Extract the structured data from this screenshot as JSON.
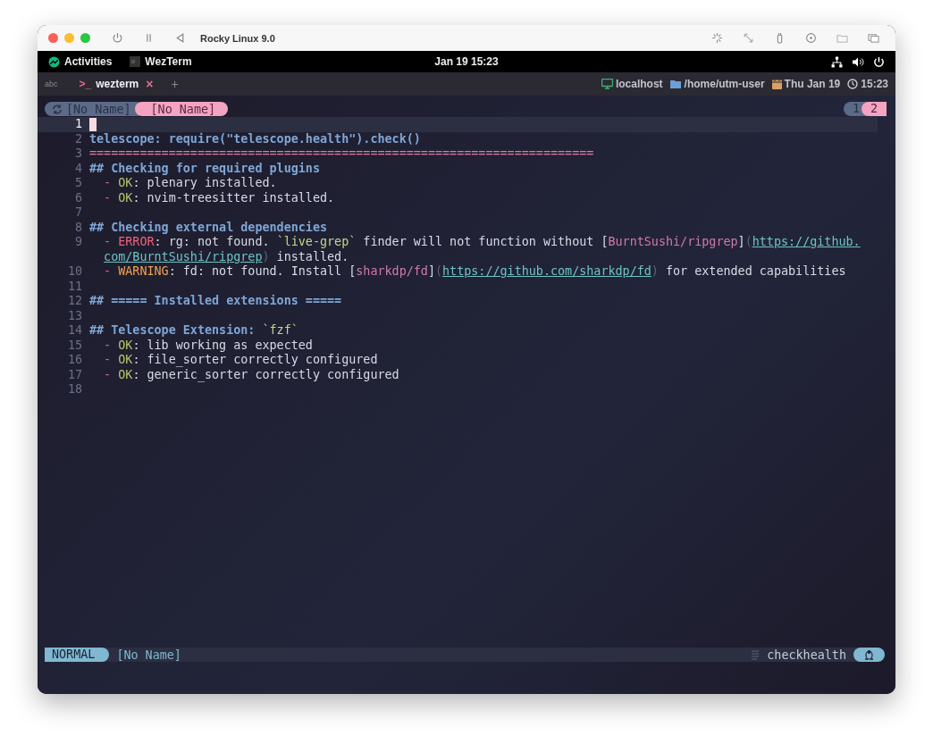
{
  "window": {
    "title": "Rocky Linux 9.0"
  },
  "top_bar": {
    "activities": "Activities",
    "app": "WezTerm",
    "clock": "Jan 19  15:23"
  },
  "terminal_tabs": {
    "left_label": "abc",
    "tabs": [
      {
        "icon": ">_",
        "label": "wezterm",
        "close": "×",
        "selected": true
      }
    ],
    "new_tab": "+",
    "status": [
      {
        "kind": "host",
        "text": "localhost"
      },
      {
        "kind": "folder",
        "text": "/home/utm-user"
      },
      {
        "kind": "date",
        "text": "Thu Jan 19"
      },
      {
        "kind": "time",
        "text": "15:23"
      }
    ]
  },
  "buffers": [
    {
      "label": "[No Name]",
      "selected": false
    },
    {
      "label": "[No Name]",
      "selected": true
    }
  ],
  "tabpages": [
    {
      "label": "1",
      "selected": false
    },
    {
      "label": "2",
      "selected": true
    }
  ],
  "editor": {
    "lines": [
      {
        "number": "1",
        "current": true
      },
      {
        "number": "2",
        "current": false,
        "segments": [
          {
            "kind": "heading",
            "text": "telescope: require(\"telescope.health\").check()"
          }
        ]
      },
      {
        "number": "3",
        "current": false,
        "segments": [
          {
            "kind": "separator",
            "text": "======================================================================"
          }
        ]
      },
      {
        "number": "4",
        "current": false,
        "segments": [
          {
            "kind": "heading",
            "text": "## Checking for required plugins"
          }
        ]
      },
      {
        "number": "5",
        "current": false,
        "segments": [
          {
            "kind": "dash",
            "text": "  - "
          },
          {
            "kind": "ok",
            "text": "OK"
          },
          {
            "kind": "plain",
            "text": ": plenary installed."
          }
        ]
      },
      {
        "number": "6",
        "current": false,
        "segments": [
          {
            "kind": "dash",
            "text": "  - "
          },
          {
            "kind": "ok",
            "text": "OK"
          },
          {
            "kind": "plain",
            "text": ": nvim-treesitter installed."
          }
        ]
      },
      {
        "number": "7",
        "current": false
      },
      {
        "number": "8",
        "current": false,
        "segments": [
          {
            "kind": "heading",
            "text": "## Checking external dependencies"
          }
        ]
      },
      {
        "number": "9",
        "current": false,
        "segments": [
          {
            "kind": "dash",
            "text": "  - "
          },
          {
            "kind": "error",
            "text": "ERROR"
          },
          {
            "kind": "plain",
            "text": ": rg: not found. "
          },
          {
            "kind": "code",
            "text": "`live-grep`"
          },
          {
            "kind": "plain",
            "text": " finder will not function without ["
          },
          {
            "kind": "link_text",
            "text": "BurntSushi/ripgrep"
          },
          {
            "kind": "plain",
            "text": "]"
          },
          {
            "kind": "muted",
            "text": "("
          },
          {
            "kind": "url",
            "text": "https://github."
          }
        ]
      },
      {
        "current": false,
        "segments": [
          {
            "kind": "url",
            "text": "com/BurntSushi/ripgrep"
          },
          {
            "kind": "muted",
            "text": ")"
          },
          {
            "kind": "plain",
            "text": " installed."
          }
        ]
      },
      {
        "number": "10",
        "current": false,
        "segments": [
          {
            "kind": "dash",
            "text": "  - "
          },
          {
            "kind": "warning",
            "text": "WARNING"
          },
          {
            "kind": "plain",
            "text": ": fd: not found. Install ["
          },
          {
            "kind": "link_text",
            "text": "sharkdp/fd"
          },
          {
            "kind": "plain",
            "text": "]"
          },
          {
            "kind": "muted",
            "text": "("
          },
          {
            "kind": "url",
            "text": "https://github.com/sharkdp/fd"
          },
          {
            "kind": "muted",
            "text": ")"
          },
          {
            "kind": "plain",
            "text": " for extended capabilities"
          }
        ]
      },
      {
        "number": "11",
        "current": false
      },
      {
        "number": "12",
        "current": false,
        "segments": [
          {
            "kind": "heading",
            "text": "## ===== Installed extensions ====="
          }
        ]
      },
      {
        "number": "13",
        "current": false
      },
      {
        "number": "14",
        "current": false,
        "segments": [
          {
            "kind": "heading",
            "text": "## Telescope Extension: "
          },
          {
            "kind": "code",
            "text": "`fzf`"
          }
        ]
      },
      {
        "number": "15",
        "current": false,
        "segments": [
          {
            "kind": "dash",
            "text": "  - "
          },
          {
            "kind": "ok",
            "text": "OK"
          },
          {
            "kind": "plain",
            "text": ": lib working as expected"
          }
        ]
      },
      {
        "number": "16",
        "current": false,
        "segments": [
          {
            "kind": "dash",
            "text": "  - "
          },
          {
            "kind": "ok",
            "text": "OK"
          },
          {
            "kind": "plain",
            "text": ": file_sorter correctly configured"
          }
        ]
      },
      {
        "number": "17",
        "current": false,
        "segments": [
          {
            "kind": "dash",
            "text": "  - "
          },
          {
            "kind": "ok",
            "text": "OK"
          },
          {
            "kind": "plain",
            "text": ": generic_sorter correctly configured"
          }
        ]
      },
      {
        "number": "18",
        "current": false
      }
    ]
  },
  "statusline": {
    "mode": "NORMAL",
    "file": "[No Name]",
    "filetype": "checkhealth"
  }
}
